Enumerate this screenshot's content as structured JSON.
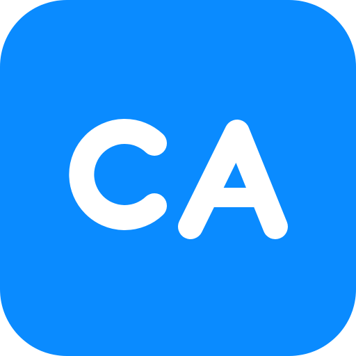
{
  "icon": {
    "text": "CA",
    "background_color": "#0a8bff",
    "glyph_color": "#ffffff"
  }
}
